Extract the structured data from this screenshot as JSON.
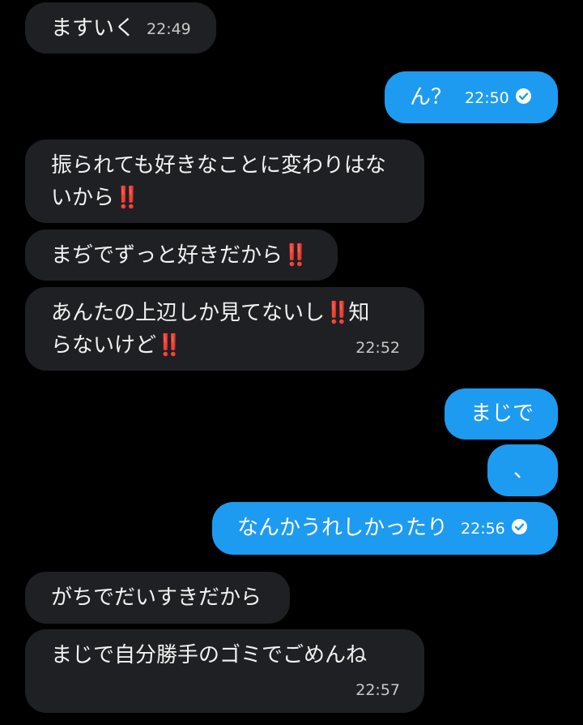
{
  "messages": [
    {
      "side": "received",
      "text": "ますいく",
      "time": "22:49"
    },
    {
      "side": "sent",
      "text": "ん？",
      "time": "22:50",
      "read": true
    },
    {
      "side": "received",
      "text_parts": [
        "振られても好きなことに変わりはな",
        "いから",
        "‼️"
      ]
    },
    {
      "side": "received",
      "text_parts": [
        "まぢでずっと好きだから",
        "‼️"
      ]
    },
    {
      "side": "received",
      "text_parts": [
        "あんたの上辺しか見てないし",
        "‼️",
        "知",
        "らないけど",
        "‼️"
      ],
      "time": "22:52"
    },
    {
      "side": "sent",
      "text": "まじで"
    },
    {
      "side": "sent",
      "text": "、"
    },
    {
      "side": "sent",
      "text": "なんかうれしかったり",
      "time": "22:56",
      "read": true
    },
    {
      "side": "received",
      "text": "がちでだいすきだから"
    },
    {
      "side": "received",
      "text": "まじで自分勝手のゴミでごめんね",
      "time": "22:57"
    }
  ],
  "colors": {
    "background": "#000000",
    "received_bubble": "#1f2023",
    "sent_bubble": "#1d9bf0",
    "emphasis": "#e0245e"
  },
  "icons": {
    "read_receipt": "check-circle-icon",
    "double_exclamation": "double-exclamation-emoji"
  }
}
